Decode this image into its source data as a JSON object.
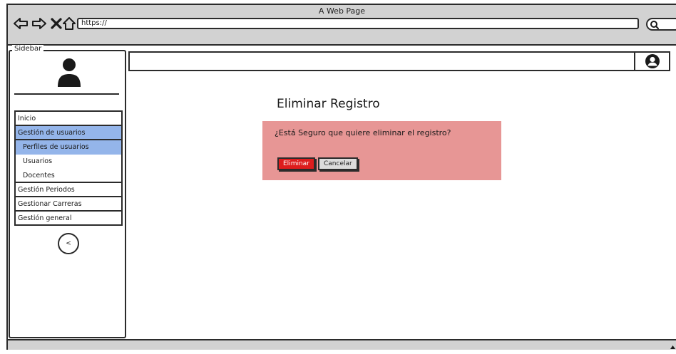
{
  "window": {
    "title": "A Web Page"
  },
  "browser": {
    "url": "https://",
    "nav_icons": [
      "back-arrow-icon",
      "forward-arrow-icon",
      "close-x-icon",
      "home-icon"
    ],
    "search_icon": "search-icon"
  },
  "sidebar": {
    "legend": "Sidebar",
    "avatar_icon": "user-avatar-icon",
    "menu": [
      {
        "label": "Inicio",
        "level": "top",
        "selected": false
      },
      {
        "label": "Gestión de usuarios",
        "level": "top",
        "selected": true
      },
      {
        "label": "Perfiles de usuarios",
        "level": "sub",
        "selected": true
      },
      {
        "label": "Usuarios",
        "level": "sub",
        "selected": false
      },
      {
        "label": "Docentes",
        "level": "sub",
        "selected": false
      },
      {
        "label": "Gestión Periodos",
        "level": "top",
        "selected": false
      },
      {
        "label": "Gestionar Carreras",
        "level": "top",
        "selected": false
      },
      {
        "label": "Gestión general",
        "level": "top",
        "selected": false
      }
    ],
    "collapse_label": "<"
  },
  "header": {
    "user_icon": "account-circle-icon"
  },
  "dialog": {
    "title": "Eliminar Registro",
    "message": "¿Está Seguro que quiere eliminar el registro?",
    "delete_label": "Eliminar",
    "cancel_label": "Cancelar"
  },
  "colors": {
    "selected_item": "#94b5ea",
    "dialog_background": "#e79695",
    "delete_button": "#dd1d1d",
    "chrome_gray": "#d2d2d2"
  }
}
